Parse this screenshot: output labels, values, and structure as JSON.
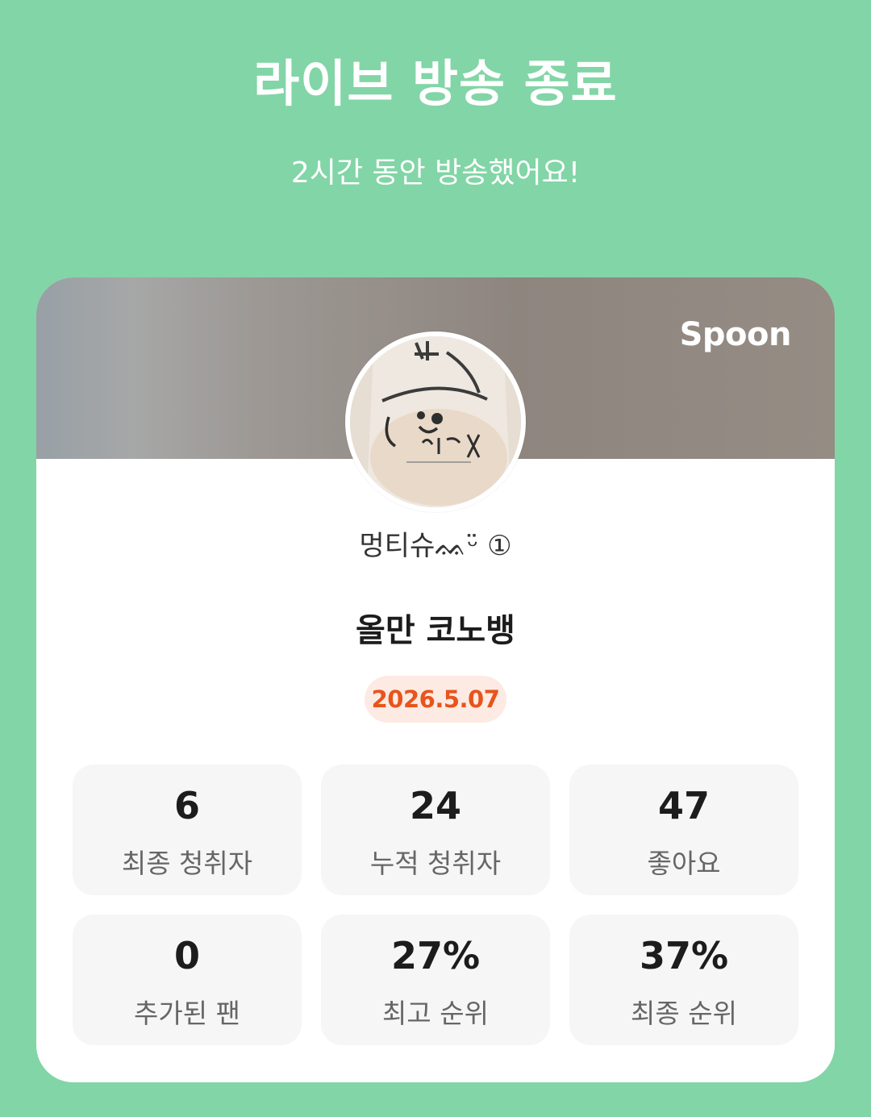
{
  "header": {
    "title": "라이브 방송 종료",
    "subtitle": "2시간 동안 방송했어요!"
  },
  "card": {
    "brand": "Spoon",
    "avatar_icon": "profile-photo",
    "username": "멍티슈ᨐᵕ̈ ①",
    "broadcast_title": "올만 코노뱅",
    "date": "2026.5.07",
    "colors": {
      "background": "#82d5a6",
      "date_badge_bg": "#fdeae3",
      "date_badge_text": "#e8541c",
      "tile_bg": "#f6f6f6"
    }
  },
  "stats": [
    {
      "value": "6",
      "label": "최종 청취자"
    },
    {
      "value": "24",
      "label": "누적 청취자"
    },
    {
      "value": "47",
      "label": "좋아요"
    },
    {
      "value": "0",
      "label": "추가된 팬"
    },
    {
      "value": "27%",
      "label": "최고 순위"
    },
    {
      "value": "37%",
      "label": "최종 순위"
    }
  ]
}
